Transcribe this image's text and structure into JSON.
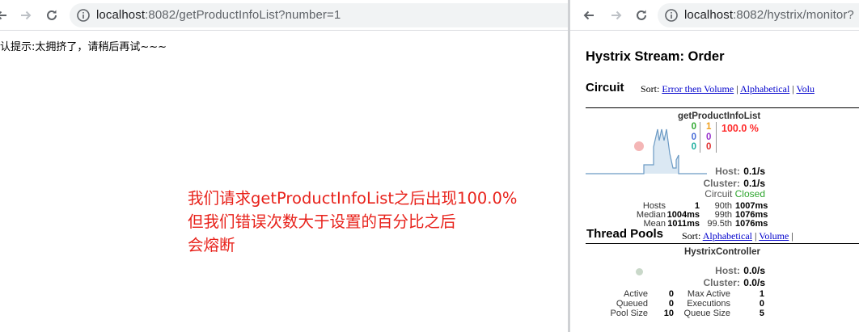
{
  "left_window": {
    "url_host": "localhost",
    "url_rest": ":8082/getProductInfoList?number=1",
    "fallback_message": "认提示:太拥挤了，请稍后再试~~~",
    "annotation_lines": [
      "我们请求getProductInfoList之后出现100.0%",
      "但我们错误次数大于设置的百分比之后",
      "会熔断"
    ]
  },
  "right_window": {
    "url_host": "localhost",
    "url_rest": ":8082/hystrix/monitor?",
    "title": "Hystrix Stream: Order",
    "circuit_section": {
      "label": "Circuit",
      "sort_prefix": "Sort:",
      "sort_links": [
        "Error then Volume",
        "Alphabetical",
        "Volu"
      ],
      "separator": "|",
      "command": {
        "name": "getProductInfoList",
        "counts_col1": [
          "0",
          "0",
          "0"
        ],
        "counts_col2": [
          "1",
          "0",
          "0"
        ],
        "error_pct": "100.0 %",
        "host_label": "Host:",
        "host_rate": "0.1/s",
        "cluster_label": "Cluster:",
        "cluster_rate": "0.1/s",
        "circuit_label": "Circuit",
        "circuit_status": "Closed",
        "latency": {
          "hosts_label": "Hosts",
          "hosts_value": "1",
          "p90_label": "90th",
          "p90_value": "1007ms",
          "median_label": "Median",
          "median_value": "1004ms",
          "p99_label": "99th",
          "p99_value": "1076ms",
          "mean_label": "Mean",
          "mean_value": "1011ms",
          "p995_label": "99.5th",
          "p995_value": "1076ms"
        }
      }
    },
    "thread_pools_section": {
      "label": "Thread Pools",
      "sort_prefix": "Sort:",
      "sort_links": [
        "Alphabetical",
        "Volume"
      ],
      "separator": "|",
      "pool": {
        "name": "HystrixController",
        "host_label": "Host:",
        "host_rate": "0.0/s",
        "cluster_label": "Cluster:",
        "cluster_rate": "0.0/s",
        "active_label": "Active",
        "active_value": "0",
        "queued_label": "Queued",
        "queued_value": "0",
        "pool_size_label": "Pool Size",
        "pool_size_value": "10",
        "max_active_label": "Max Active",
        "max_active_value": "1",
        "executions_label": "Executions",
        "executions_value": "0",
        "queue_size_label": "Queue Size",
        "queue_size_value": "5"
      }
    }
  },
  "colors": {
    "annotation_red": "#e8221b",
    "count_green": "#33aa33",
    "count_blue": "#4b6fd8",
    "count_teal": "#1fb0a0",
    "count_orange": "#f0a020",
    "count_purple": "#9933cc",
    "count_red": "#e03030",
    "error_red": "#ff2a2a",
    "closed_green": "#2ea52e",
    "link_blue": "#0000cc"
  }
}
